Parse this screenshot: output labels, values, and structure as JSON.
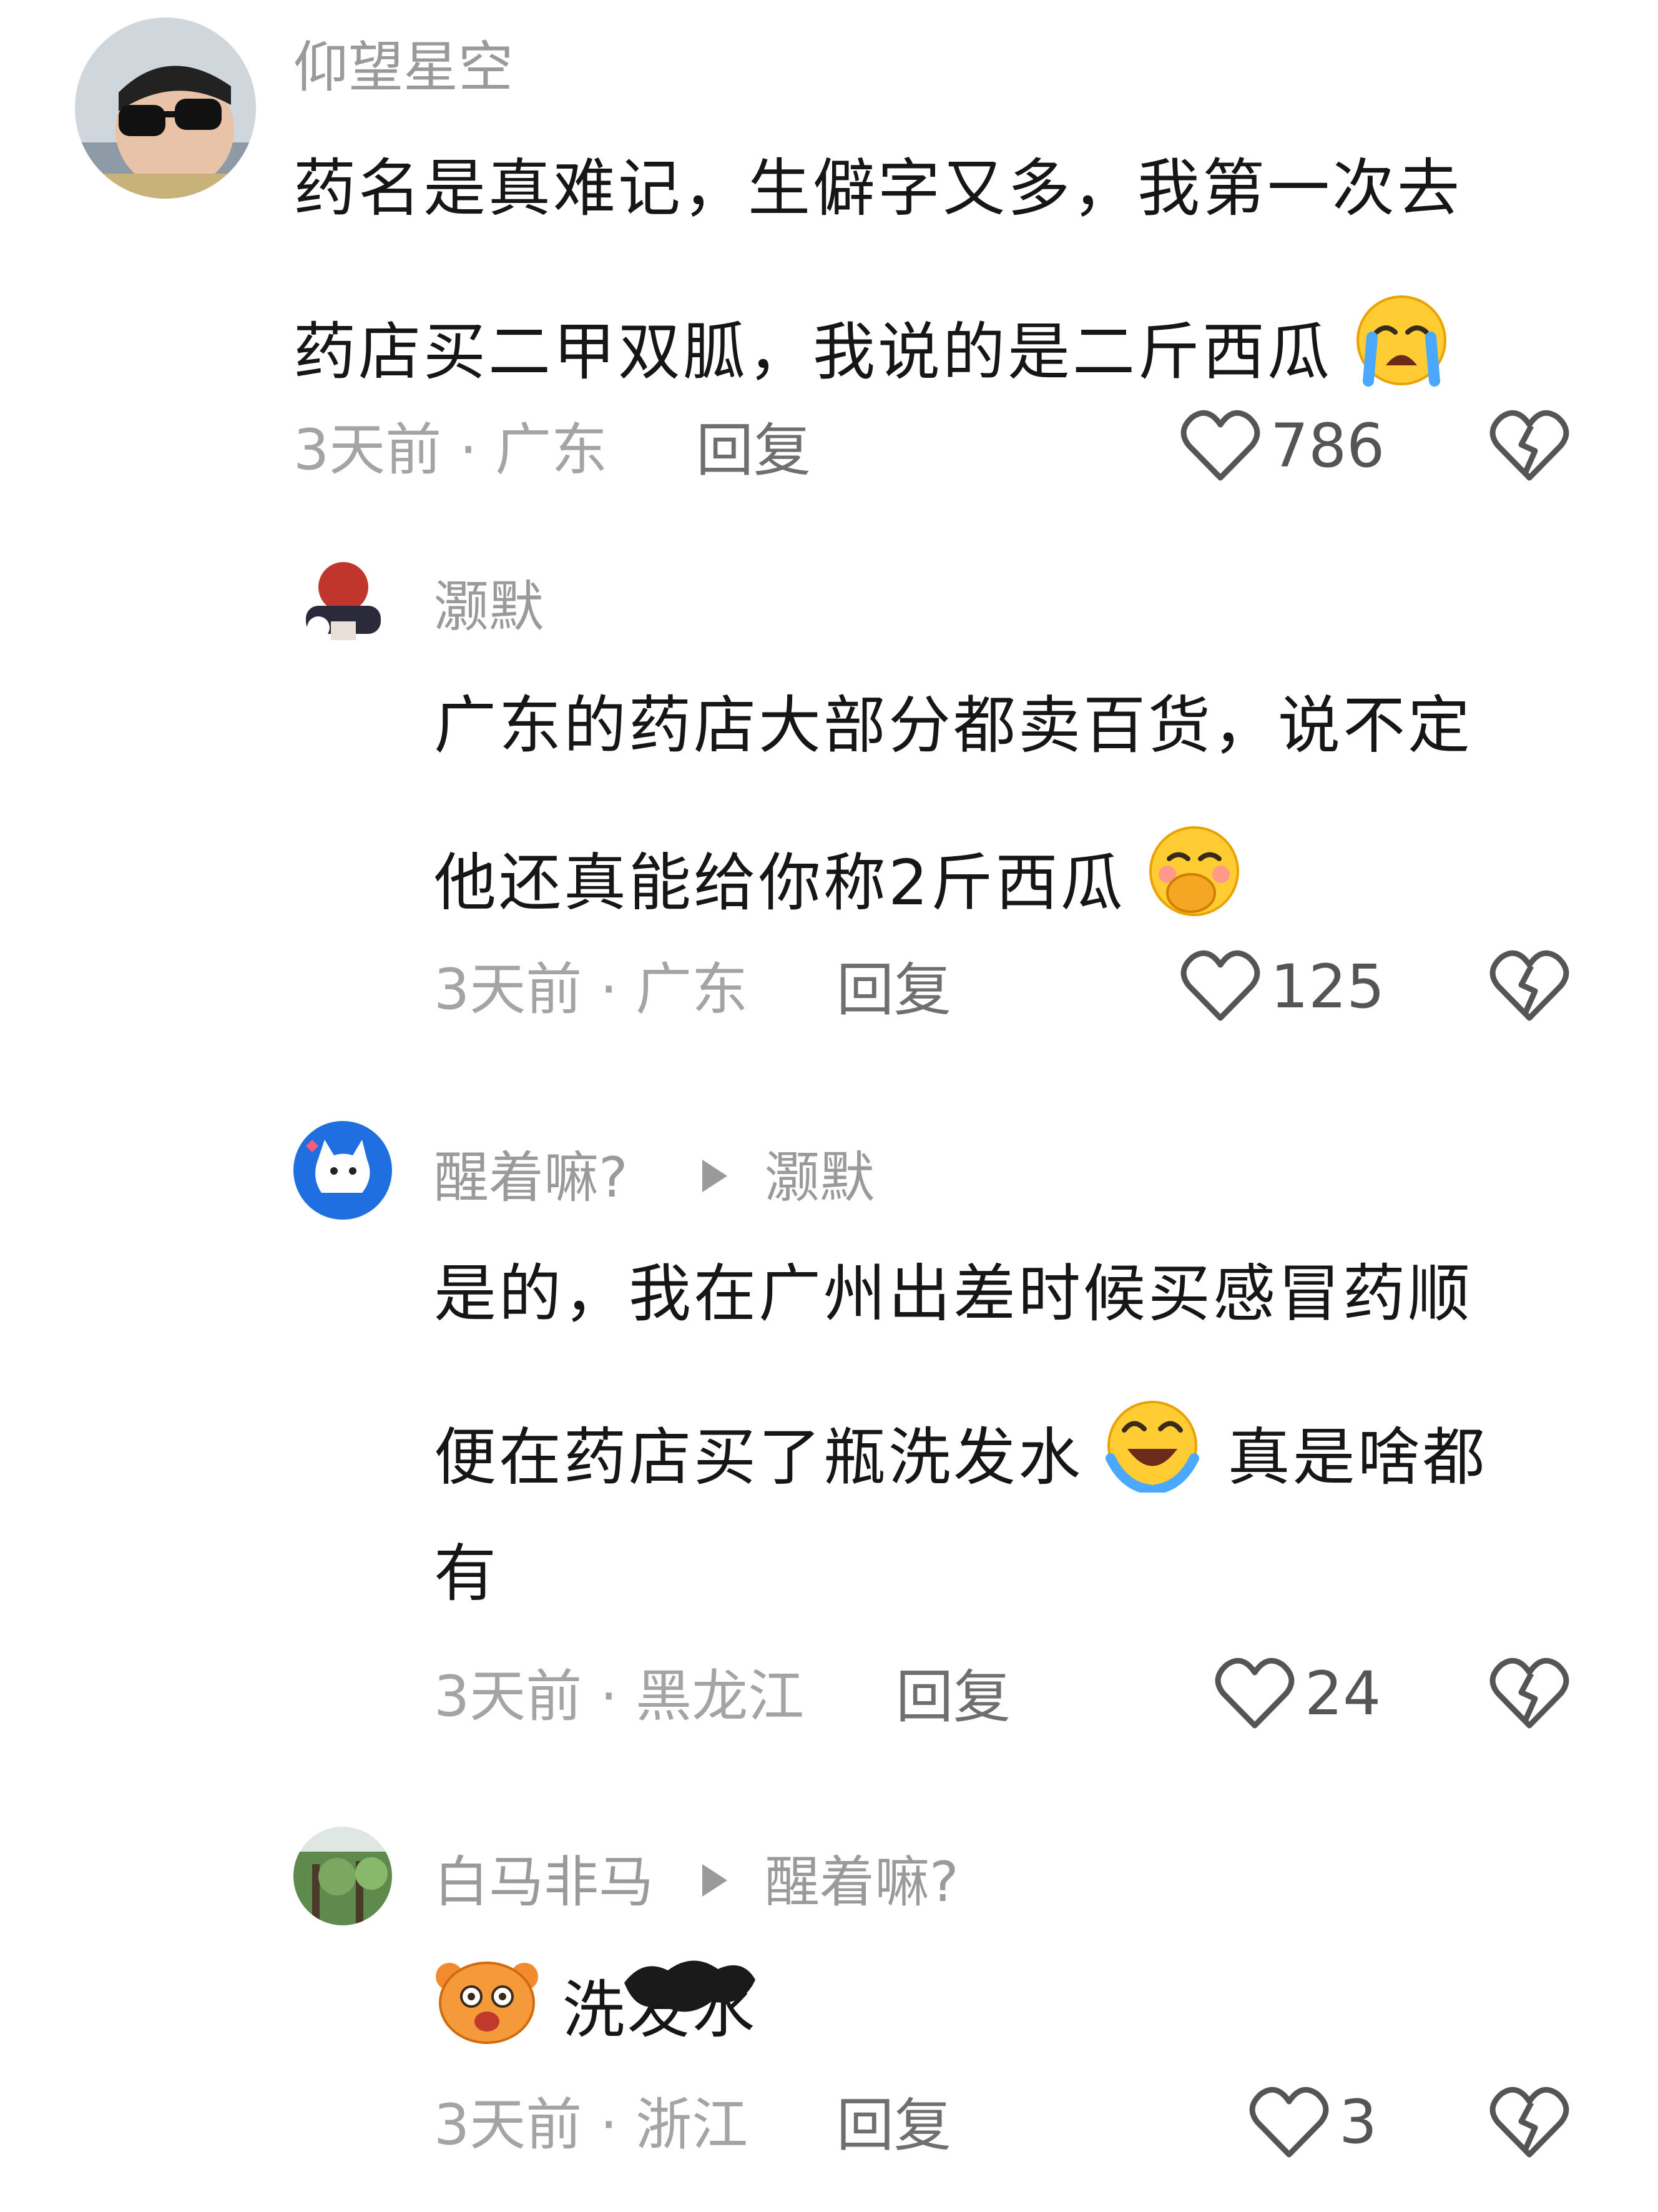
{
  "comments": [
    {
      "username": "仰望星空",
      "lines": [
        "药名是真难记，生僻字又多，我第一次去",
        "药店买二甲双胍，我说的是二斤西瓜"
      ],
      "time": "3天前 · 广东",
      "reply": "回复",
      "likes": "786",
      "emoji": "crying-face"
    },
    {
      "username": "灏默",
      "lines": [
        "广东的药店大部分都卖百货，说不定",
        "他还真能给你称2斤西瓜"
      ],
      "time": "3天前 · 广东",
      "reply": "回复",
      "likes": "125",
      "emoji": "hand-over-mouth-face"
    },
    {
      "username": "醒着嘛?",
      "reply_to": "灏默",
      "lines": [
        "是的，我在广州出差时候买感冒药顺",
        "便在药店买了瓶洗发水",
        "真是啥都",
        "有"
      ],
      "time": "3天前 · 黑龙江",
      "reply": "回复",
      "likes": "24",
      "emoji": "rolling-laughing-face"
    },
    {
      "username": "白马非马",
      "reply_to": "醒着嘛?",
      "lines": [
        "洗发水"
      ],
      "time": "3天前 · 浙江",
      "reply": "回复",
      "likes": "3",
      "emoji": "bear-face"
    }
  ],
  "icons": {
    "like": "heart-outline-icon",
    "dislike": "broken-heart-icon",
    "reply_arrow": "play-arrow-icon"
  },
  "colors": {
    "text": "#161616",
    "meta": "#a4a4a4",
    "username": "#9a9a9a"
  }
}
